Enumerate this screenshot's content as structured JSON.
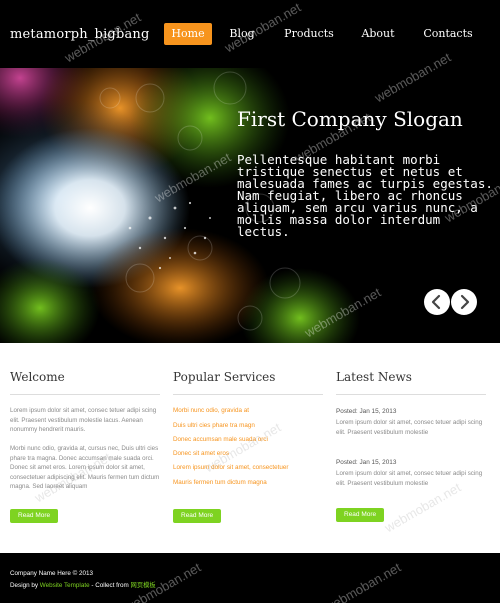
{
  "header": {
    "logo": "metamorph_bigbang",
    "nav": [
      "Home",
      "Blog",
      "Products",
      "About",
      "Contacts"
    ],
    "active_index": 0,
    "accent_color": "#f7941d"
  },
  "banner": {
    "slogan_title": "First Company Slogan",
    "slogan_text": "Pellentesque habitant morbi tristique senectus et netus et malesuada fames ac turpis egestas. Nam feugiat, libero ac rhoncus aliquam, sem arcu varius nunc, a mollis massa dolor interdum lectus.",
    "prev_icon": "chevron-left-icon",
    "next_icon": "chevron-right-icon"
  },
  "welcome": {
    "title": "Welcome",
    "para1": "Lorem ipsum dolor sit amet, consec tetuer adipi scing elit. Praesent vestibulum molestie lacus. Aenean nonummy hendrerit mauris.",
    "para2": "Morbi nunc odio, gravida at, cursus nec, Duis ultri cies phare tra magna. Donec accumsan male suada orci. Donec sit amet eros. Lorem ipsum dolor sit amet, consectetuer adipiscing elit. Mauris fermen tum dictum magna. Sed laoreet aliquam",
    "button": "Read More"
  },
  "services": {
    "title": "Popular Services",
    "items": [
      "Morbi nunc odio, gravida at",
      "Duis ultri cies phare tra magn",
      "Donec accumsan male suada orci",
      "Donec sit amet eros",
      "Lorem ipsum dolor sit amet, consectetuer",
      "Mauris fermen tum dictum magna"
    ],
    "button": "Read More",
    "link_color": "#f7941d"
  },
  "news": {
    "title": "Latest News",
    "items": [
      {
        "date": "Posted: Jan 15, 2013",
        "text": "Lorem ipsum dolor sit amet, consec tetuer adipi scing elit. Praesent vestibulum molestie"
      },
      {
        "date": "Posted: Jan 15, 2013",
        "text": "Lorem ipsum dolor sit amet, consec tetuer adipi scing elit. Praesent vestibulum molestie"
      }
    ],
    "button": "Read More",
    "button_color": "#7ed321"
  },
  "footer": {
    "line1": "Company Name Here © 2013",
    "line2_prefix": "Design by",
    "line2_link": "Website Template",
    "line2_mid": "- Collect from",
    "line2_link2": "网页模板"
  },
  "watermark": "webmoban.net"
}
